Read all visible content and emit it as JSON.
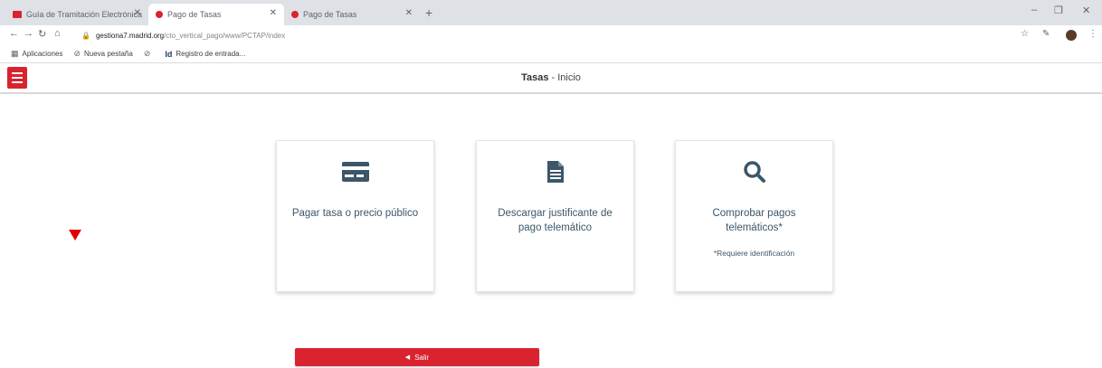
{
  "browser": {
    "tabs": [
      {
        "title": "Guía de Tramitación Electrónica",
        "favicon_color": "#d9232f",
        "active": false
      },
      {
        "title": "Pago de Tasas",
        "favicon_color": "#d9232f",
        "active": true
      },
      {
        "title": "Pago de Tasas",
        "favicon_color": "#d9232f",
        "active": false
      }
    ],
    "new_tab_label": "+",
    "address": {
      "host": "gestiona7.madrid.org",
      "path": "/cto_vertical_pago/www/PCTAP/index"
    },
    "bookmarks": [
      {
        "icon": "apps-icon",
        "label": "Aplicaciones"
      },
      {
        "icon": "globe-icon",
        "label": "Nueva pestaña"
      },
      {
        "icon": "globe-icon",
        "label": ""
      },
      {
        "icon": "id-icon",
        "label": "Registro de entrada..."
      }
    ]
  },
  "header": {
    "breadcrumb_section": "Tasas",
    "breadcrumb_sep": "-",
    "breadcrumb_current": "Inicio",
    "accent_color": "#d9232f"
  },
  "cards": [
    {
      "icon": "credit-card-icon",
      "label": "Pagar tasa o precio público",
      "note": ""
    },
    {
      "icon": "document-icon",
      "label": "Descargar justificante de pago telemático",
      "note": ""
    },
    {
      "icon": "search-icon",
      "label": "Comprobar pagos telemáticos*",
      "note": "*Requiere identificación"
    }
  ],
  "exit_button": {
    "label": "Salir",
    "icon": "exit-icon"
  }
}
